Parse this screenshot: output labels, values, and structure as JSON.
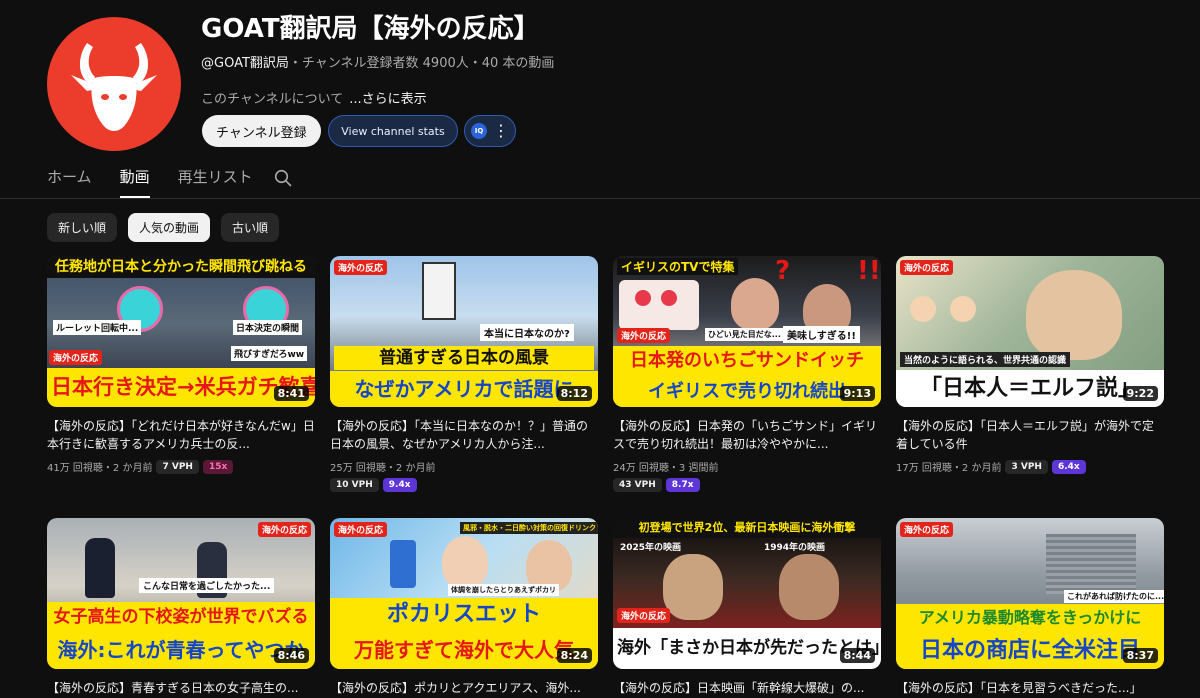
{
  "channel": {
    "title": "GOAT翻訳局【海外の反応】",
    "handle": "@GOAT翻訳局",
    "meta_rest": "・チャンネル登録者数 4900人・40 本の動画",
    "about": "このチャンネルについて",
    "more": "...さらに表示",
    "subscribe_label": "チャンネル登録",
    "stats_label": "View channel stats",
    "ext_label": "IQ",
    "avatar_color": "#ec3c2b"
  },
  "tabs": [
    "ホーム",
    "動画",
    "再生リスト"
  ],
  "active_tab": "動画",
  "chips": [
    "新しい順",
    "人気の動画",
    "古い順"
  ],
  "active_chip": "人気の動画",
  "videos": [
    {
      "duration": "8:41",
      "title": "【海外の反応】「どれだけ日本が好きなんだw」日本行きに歓喜するアメリカ兵士の反...",
      "views": "41万 回視聴・2 か月前",
      "vph": "7 VPH",
      "mult": "15x",
      "thumb_top": "任務地が日本と分かった瞬間飛び跳ねる",
      "thumb_mid": "飛びすぎだろww",
      "thumb_bottom": "日本行き決定→米兵ガチ歓喜",
      "thumb_badge": "海外の反応",
      "thumb_note1": "ルーレット回転中...",
      "thumb_note2": "日本決定の瞬間"
    },
    {
      "duration": "8:12",
      "title": "【海外の反応】「本当に日本なのか！？」普通の日本の風景、なぜかアメリカ人から注...",
      "views": "25万 回視聴・2 か月前",
      "vph": "10 VPH",
      "mult": "9.4x",
      "thumb_top": "普通すぎる日本の風景",
      "thumb_mid": "本当に日本なのか?",
      "thumb_bottom": "なぜかアメリカで話題に",
      "thumb_badge": "海外の反応"
    },
    {
      "duration": "9:13",
      "title": "【海外の反応】日本発の「いちごサンド」イギリスで売り切れ続出！最初は冷ややかに...",
      "views": "24万 回視聴・3 週間前",
      "vph": "43 VPH",
      "mult": "8.7x",
      "thumb_top": "イギリスのTVで特集",
      "thumb_mid": "美味しすぎる!!",
      "thumb_bottom1": "日本発のいちごサンドイッチ",
      "thumb_bottom2": "イギリスで売り切れ続出",
      "thumb_badge": "海外の反応",
      "thumb_note1": "ひどい見た目だな...",
      "thumb_q": "?",
      "thumb_ex": "!!"
    },
    {
      "duration": "9:22",
      "title": "【海外の反応】「日本人＝エルフ説」が海外で定着している件",
      "views": "17万 回視聴・2 か月前",
      "vph": "3 VPH",
      "mult": "6.4x",
      "thumb_mid": "当然のように語られる、世界共通の認識",
      "thumb_bottom": "「日本人＝エルフ説」",
      "thumb_badge": "海外の反応"
    },
    {
      "duration": "8:46",
      "title": "【海外の反応】青春すぎる日本の女子高生の...",
      "thumb_top": "女子高生の下校姿が世界でバズる",
      "thumb_mid": "こんな日常を過ごしたかった...",
      "thumb_bottom": "海外:これが青春ってやつか",
      "thumb_badge": "海外の反応"
    },
    {
      "duration": "8:24",
      "title": "【海外の反応】ポカリとアクエリアス、海外...",
      "thumb_top": "ポカリスエット",
      "thumb_mid": "体調を崩したらとりあえずポカリ",
      "thumb_bottom": "万能すぎて海外で大人気",
      "thumb_badge": "海外の反応",
      "thumb_note1": "風邪・脱水・二日酔い対策の回復ドリンク"
    },
    {
      "duration": "8:44",
      "title": "【海外の反応】日本映画「新幹線大爆破」の...",
      "thumb_top": "初登場で世界2位、最新日本映画に海外衝撃",
      "thumb_mid1": "2025年の映画",
      "thumb_mid2": "1994年の映画",
      "thumb_bottom": "海外「まさか日本が先だったとは」",
      "thumb_badge": "海外の反応"
    },
    {
      "duration": "8:37",
      "title": "【海外の反応】「日本を見習うべきだった...」",
      "thumb_top": "アメリカ暴動略奪をきっかけに",
      "thumb_mid": "これがあれば防げたのに...",
      "thumb_bottom": "日本の商店に全米注目",
      "thumb_badge": "海外の反応"
    }
  ]
}
